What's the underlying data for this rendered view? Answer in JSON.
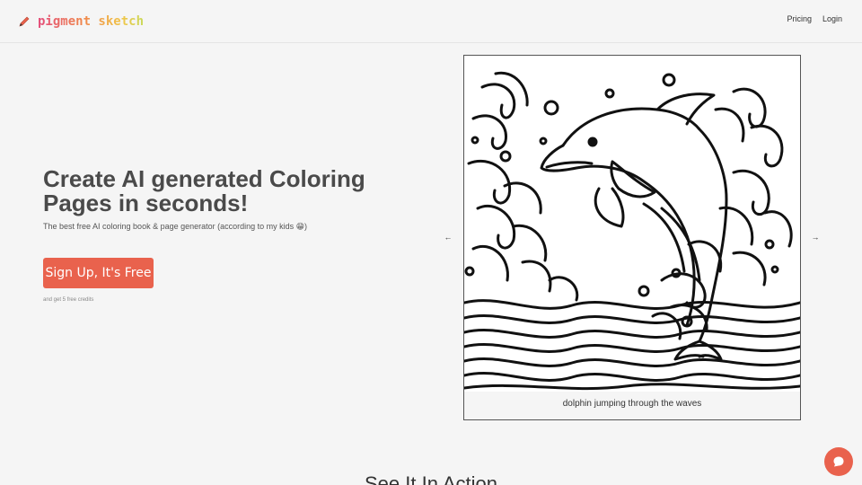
{
  "header": {
    "logo_text": "pigment sketch",
    "logo_icon": "pencil-icon",
    "nav": [
      {
        "label": "Pricing"
      },
      {
        "label": "Login"
      }
    ]
  },
  "hero": {
    "title": "Create AI generated Coloring Pages in seconds!",
    "subtitle": "The best free AI coloring book & page generator (according to my kids 😁)",
    "cta_label": "Sign Up, It's Free",
    "cta_note": "and get 5 free credits"
  },
  "carousel": {
    "prev_label": "←",
    "next_label": "→",
    "caption": "dolphin jumping through the waves",
    "image_alt": "dolphin-coloring-page"
  },
  "section": {
    "heading": "See It In Action"
  },
  "colors": {
    "accent": "#e9624d",
    "background": "#f5f5f5"
  },
  "chat": {
    "icon": "chat-bubble-icon"
  }
}
